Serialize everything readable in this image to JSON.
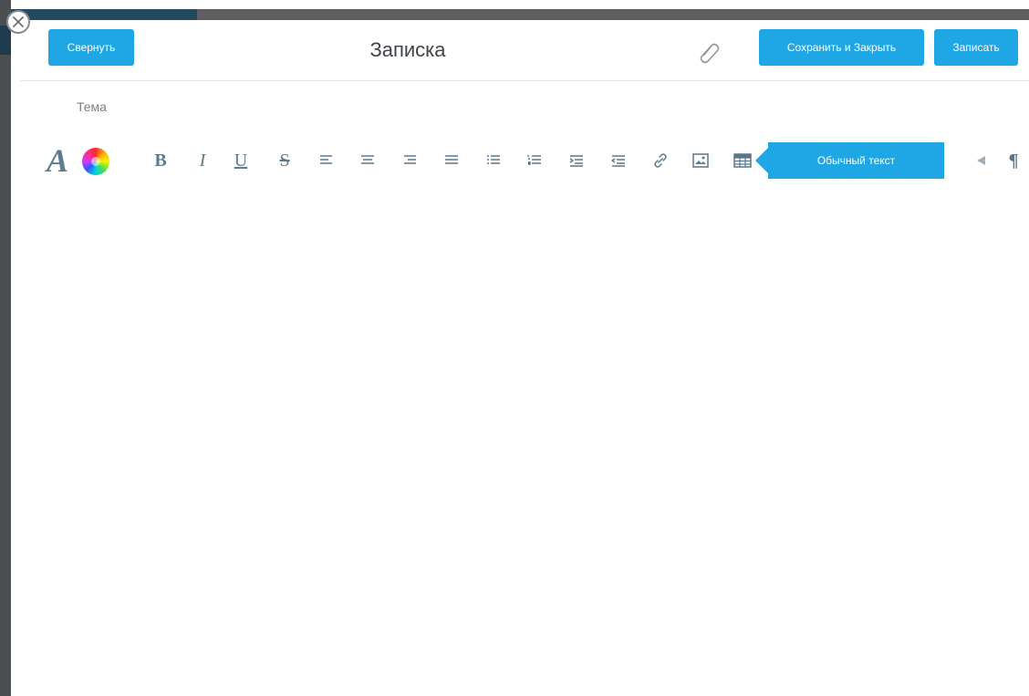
{
  "header": {
    "collapse_label": "Свернуть",
    "title": "Записка",
    "attach_icon": "paperclip-icon",
    "save_close_label": "Сохранить и Закрыть",
    "save_label": "Записать"
  },
  "subject": {
    "label": "Тема"
  },
  "toolbar": {
    "font_icon": "A",
    "color_icon": "color-wheel-icon",
    "bold": "B",
    "italic": "I",
    "underline": "U",
    "strikethrough": "S",
    "paragraph_style": "Обычный текст",
    "text_direction_icon": "text-direction-icon",
    "show_formatting_icon": "¶"
  },
  "window": {
    "close_icon": "close-icon"
  },
  "colors": {
    "accent": "#1fa7e5",
    "icon": "#5c7688",
    "title": "#3f4449"
  }
}
